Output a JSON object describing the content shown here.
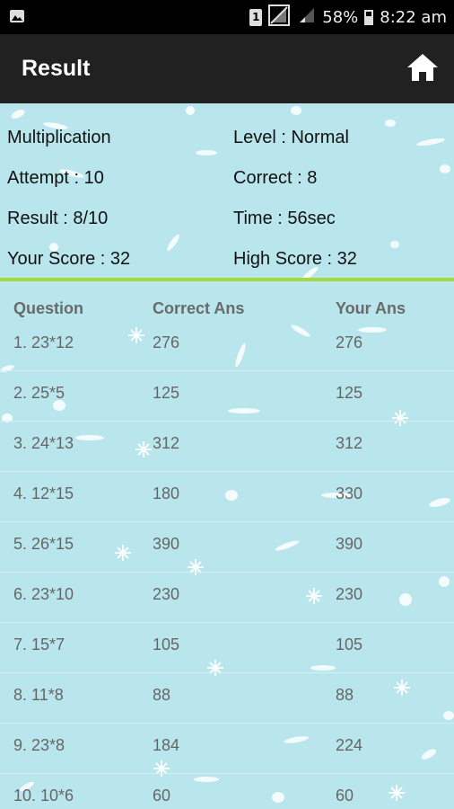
{
  "status": {
    "sim": "1",
    "battery": "58%",
    "time": "8:22 am",
    "icons": [
      "image-icon",
      "sim-icon",
      "signal-icon",
      "signal-weak-icon",
      "battery-icon"
    ]
  },
  "appbar": {
    "title": "Result",
    "home_icon": "home-icon"
  },
  "summary": {
    "mode": "Multiplication",
    "level": "Level : Normal",
    "attempt": "Attempt : 10",
    "correct": "Correct : 8",
    "result": "Result : 8/10",
    "time": "Time : 56sec",
    "score": "Your Score : 32",
    "high_score": "High Score : 32"
  },
  "table": {
    "headers": [
      "Question",
      "Correct Ans",
      "Your Ans"
    ],
    "rows": [
      {
        "q": "1. 23*12",
        "correct": "276",
        "yours": "276"
      },
      {
        "q": "2. 25*5",
        "correct": "125",
        "yours": "125"
      },
      {
        "q": "3. 24*13",
        "correct": "312",
        "yours": "312"
      },
      {
        "q": "4. 12*15",
        "correct": "180",
        "yours": "330"
      },
      {
        "q": "5. 26*15",
        "correct": "390",
        "yours": "390"
      },
      {
        "q": "6. 23*10",
        "correct": "230",
        "yours": "230"
      },
      {
        "q": "7. 15*7",
        "correct": "105",
        "yours": "105"
      },
      {
        "q": "8. 11*8",
        "correct": "88",
        "yours": "88"
      },
      {
        "q": "9. 23*8",
        "correct": "184",
        "yours": "224"
      },
      {
        "q": "10. 10*6",
        "correct": "60",
        "yours": "60"
      }
    ]
  },
  "colors": {
    "background": "#b9e6ec",
    "appbar": "#212121",
    "statusbar": "#000000",
    "divider": "#a6d93b",
    "header_text": "#6a6a6a",
    "cell_text": "#666666"
  }
}
